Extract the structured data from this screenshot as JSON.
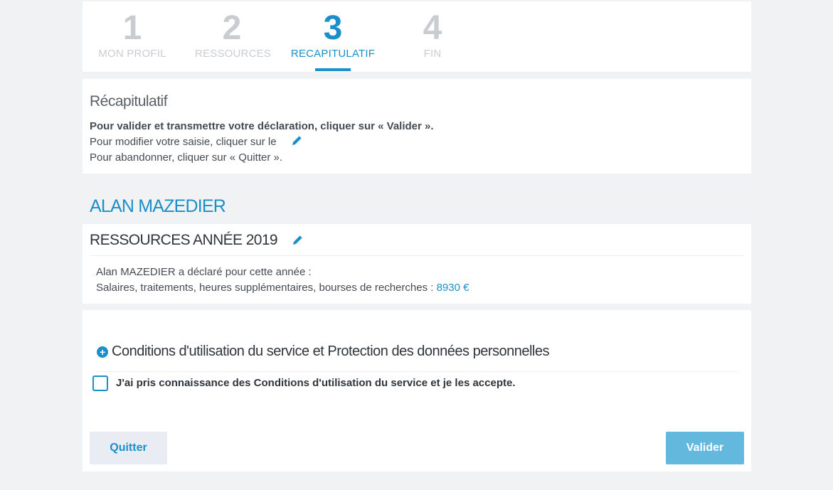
{
  "stepper": {
    "steps": [
      {
        "number": "1",
        "label": "MON PROFIL"
      },
      {
        "number": "2",
        "label": "RESSOURCES"
      },
      {
        "number": "3",
        "label": "RECAPITULATIF"
      },
      {
        "number": "4",
        "label": "FIN"
      }
    ],
    "active_step": 3
  },
  "recap": {
    "title": "Récapitulatif",
    "line_validate": "Pour valider et transmettre votre déclaration, cliquer sur « Valider ».",
    "line_modify": "Pour modifier votre saisie, cliquer sur le",
    "line_quit": "Pour abandonner, cliquer sur « Quitter »."
  },
  "person": {
    "name": "ALAN MAZEDIER"
  },
  "resources": {
    "title": "RESSOURCES ANNÉE 2019",
    "declared_line": "Alan MAZEDIER a déclaré pour cette année :",
    "income_label": "Salaires, traitements, heures supplémentaires, bourses de recherches :",
    "income_amount": "8930 €"
  },
  "conditions": {
    "title": "Conditions d'utilisation du service et Protection des données personnelles",
    "checkbox_label": "J'ai pris connaissance des Conditions d'utilisation du service et je les accepte.",
    "checked": false
  },
  "actions": {
    "quit_label": "Quitter",
    "validate_label": "Valider"
  },
  "colors": {
    "accent": "#1a8fc9",
    "inactive_step": "#c9cdd2",
    "validate_button": "#63b8de",
    "quit_button_bg": "#eaecf3"
  },
  "icons": {
    "edit": "pencil-icon",
    "expand": "plus-circle-icon"
  }
}
